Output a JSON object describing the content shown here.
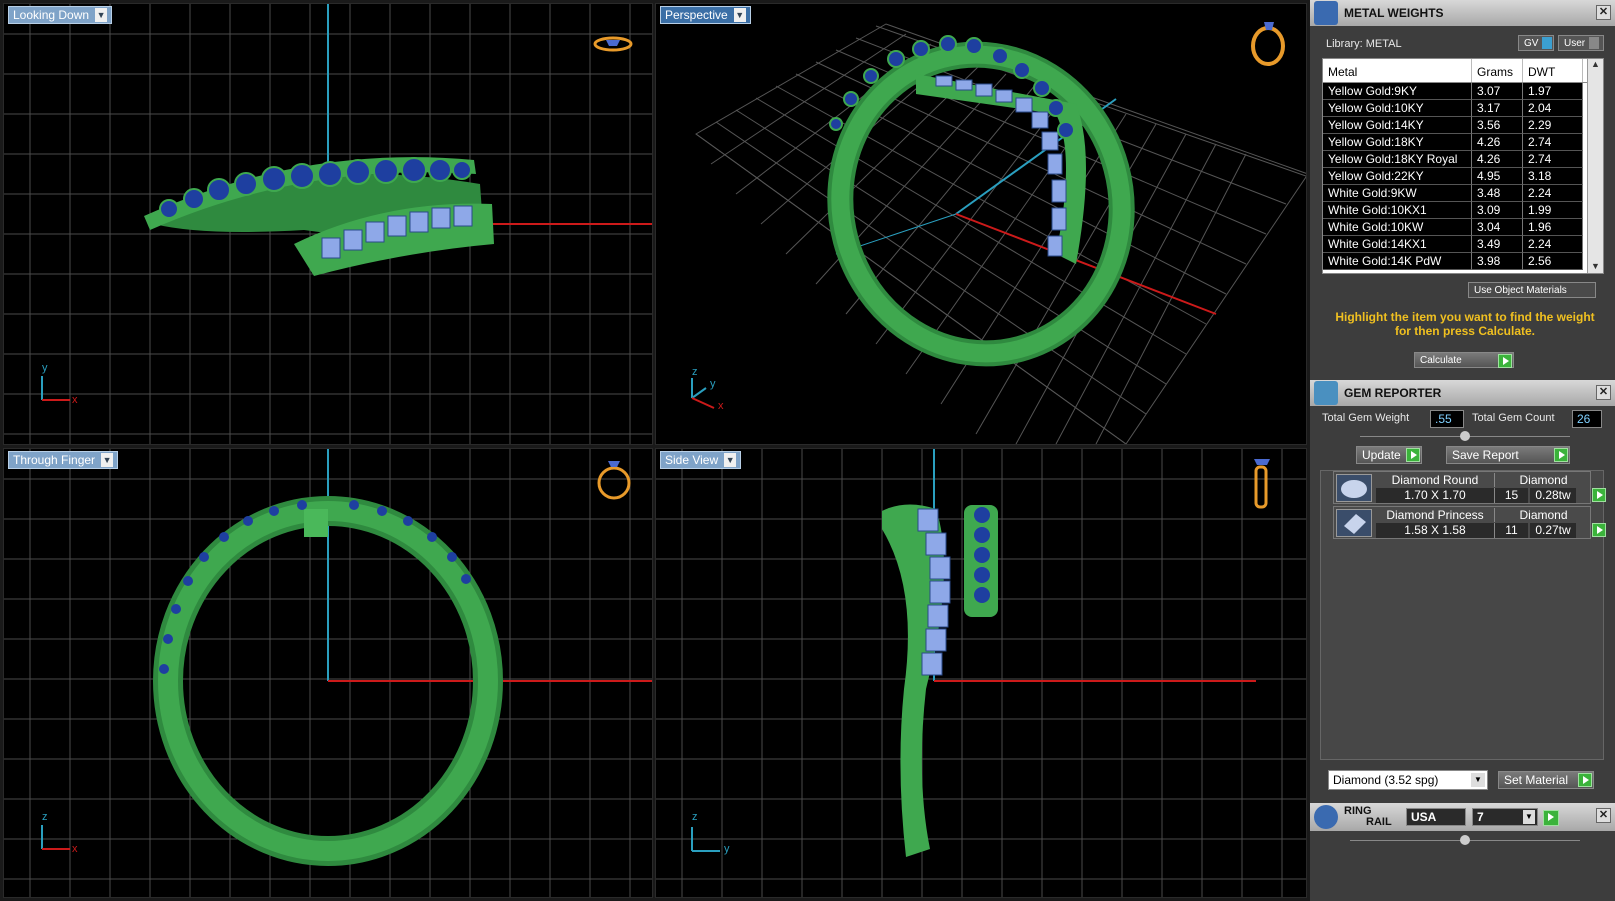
{
  "viewports": {
    "top_left": {
      "label": "Looking Down",
      "axis1": "y",
      "axis2": "x"
    },
    "top_right": {
      "label": "Perspective",
      "axis1": "z",
      "axis2": "y",
      "axis3": "x"
    },
    "bottom_left": {
      "label": "Through Finger",
      "axis1": "z",
      "axis2": "x"
    },
    "bottom_right": {
      "label": "Side View",
      "axis1": "z",
      "axis2": "y"
    }
  },
  "metal_weights": {
    "title": "METAL WEIGHTS",
    "library_label": "Library: METAL",
    "gv_label": "GV",
    "user_label": "User",
    "columns": [
      "Metal",
      "Grams",
      "DWT"
    ],
    "rows": [
      {
        "metal": "Yellow Gold:9KY",
        "grams": "3.07",
        "dwt": "1.97"
      },
      {
        "metal": "Yellow Gold:10KY",
        "grams": "3.17",
        "dwt": "2.04"
      },
      {
        "metal": "Yellow Gold:14KY",
        "grams": "3.56",
        "dwt": "2.29"
      },
      {
        "metal": "Yellow Gold:18KY",
        "grams": "4.26",
        "dwt": "2.74"
      },
      {
        "metal": "Yellow Gold:18KY Royal",
        "grams": "4.26",
        "dwt": "2.74"
      },
      {
        "metal": "Yellow Gold:22KY",
        "grams": "4.95",
        "dwt": "3.18"
      },
      {
        "metal": "White Gold:9KW",
        "grams": "3.48",
        "dwt": "2.24"
      },
      {
        "metal": "White Gold:10KX1",
        "grams": "3.09",
        "dwt": "1.99"
      },
      {
        "metal": "White Gold:10KW",
        "grams": "3.04",
        "dwt": "1.96"
      },
      {
        "metal": "White Gold:14KX1",
        "grams": "3.49",
        "dwt": "2.24"
      },
      {
        "metal": "White Gold:14K PdW",
        "grams": "3.98",
        "dwt": "2.56"
      }
    ],
    "use_object_materials": "Use Object Materials",
    "hint": "Highlight the item you want to find the weight for then press Calculate.",
    "calculate": "Calculate"
  },
  "gem_reporter": {
    "title": "GEM REPORTER",
    "total_weight_label": "Total Gem Weight",
    "total_weight_value": ".55",
    "total_count_label": "Total Gem Count",
    "total_count_value": "26",
    "update": "Update",
    "save_report": "Save Report",
    "gems": [
      {
        "name": "Diamond Round",
        "material": "Diamond",
        "size": "1.70 X 1.70",
        "count": "15",
        "tw": "0.28tw"
      },
      {
        "name": "Diamond Princess",
        "material": "Diamond",
        "size": "1.58 X 1.58",
        "count": "11",
        "tw": "0.27tw"
      }
    ],
    "material_select": "Diamond    (3.52 spg)",
    "set_material": "Set Material"
  },
  "ring_rail": {
    "title_1": "RING",
    "title_2": "RAIL",
    "country": "USA",
    "size": "7"
  },
  "colors": {
    "ring": "#3fa84f",
    "gem": "#1e3fa0",
    "princess": "#8ea8e8",
    "grid": "#4a4a4a",
    "x_axis": "#cc1a1a",
    "y_axis": "#2a9fbf"
  }
}
